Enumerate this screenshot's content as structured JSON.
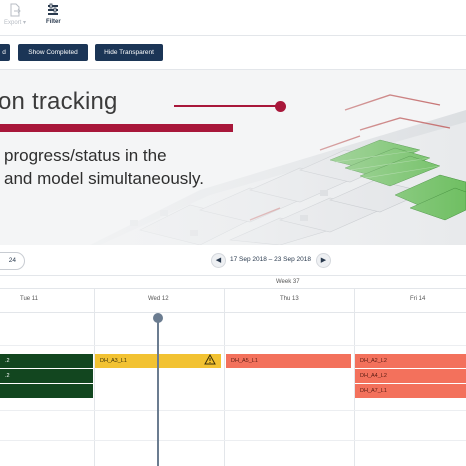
{
  "toolbar": {
    "export_label": "Export",
    "filter_label": "Filter"
  },
  "actions": {
    "button0_label": "d",
    "show_completed_label": "Show Completed",
    "hide_transparent_label": "Hide Transparent"
  },
  "hero": {
    "title": "on tracking",
    "subtitle_line1": "progress/status in the",
    "subtitle_line2": "and model simultaneously.",
    "accent_color": "#a8173a"
  },
  "calendar": {
    "zoom_pill": "24",
    "prev_label": "◀",
    "next_label": "▶",
    "date_range": "17 Sep 2018 – 23 Sep 2018",
    "week_label": "Week 37",
    "days": [
      "Tue 11",
      "Wed 12",
      "Thu 13",
      "Fri 14"
    ],
    "tasks": [
      {
        "label": ".2",
        "status": "green"
      },
      {
        "label": ".2",
        "status": "green"
      },
      {
        "label": "",
        "status": "green"
      },
      {
        "label": "DH_A3_L1",
        "status": "yellow"
      },
      {
        "label": "DH_A5_L1",
        "status": "red"
      },
      {
        "label": "DH_A2_L2",
        "status": "red"
      },
      {
        "label": "DH_A4_L2",
        "status": "red"
      },
      {
        "label": "DH_A7_L1",
        "status": "red"
      }
    ],
    "status_colors": {
      "green": "#12461f",
      "yellow": "#f2c232",
      "red": "#f3715c",
      "buttons": "#1b3556"
    }
  }
}
